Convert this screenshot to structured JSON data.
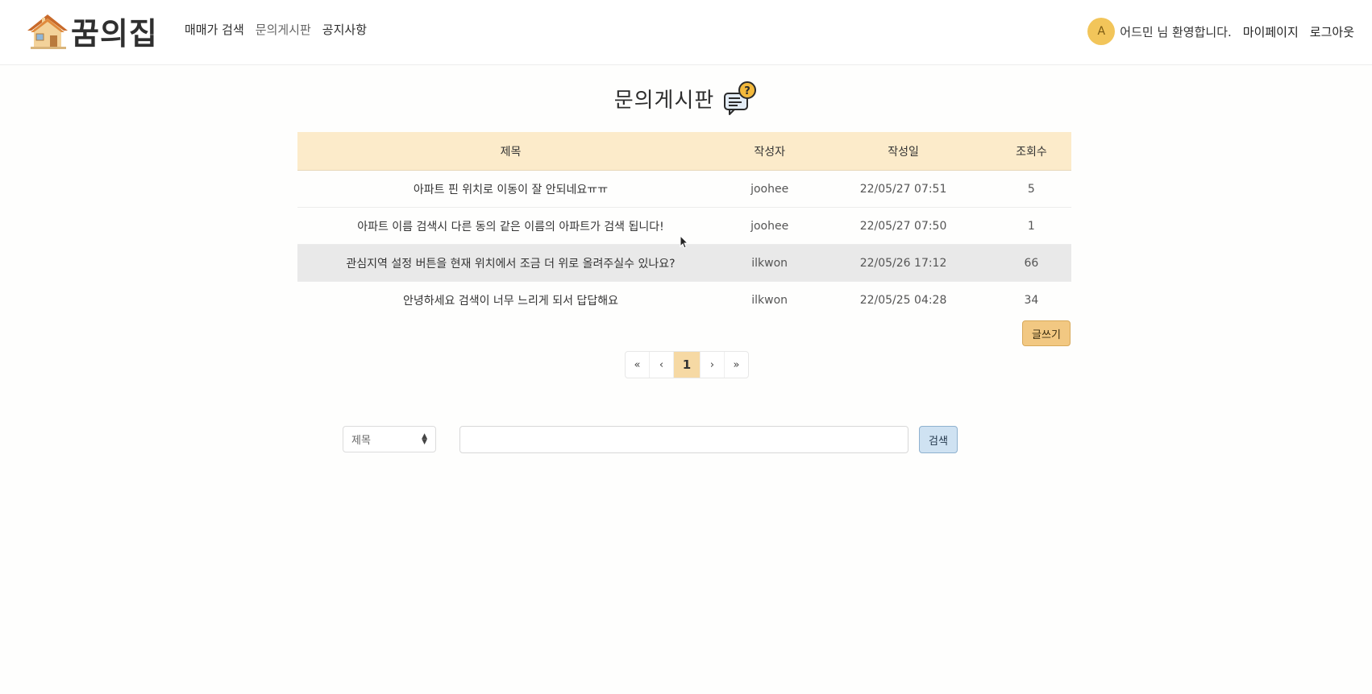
{
  "brand": {
    "name": "꿈의집"
  },
  "nav": {
    "items": [
      {
        "label": "매매가 검색"
      },
      {
        "label": "문의게시판"
      },
      {
        "label": "공지사항"
      }
    ]
  },
  "user": {
    "avatar_initial": "A",
    "welcome": "어드민 님 환영합니다.",
    "mypage": "마이페이지",
    "logout": "로그아웃"
  },
  "page": {
    "title": "문의게시판",
    "title_icon": "question-chat-icon"
  },
  "table": {
    "headers": {
      "title": "제목",
      "author": "작성자",
      "date": "작성일",
      "views": "조회수"
    },
    "rows": [
      {
        "title": "아파트 핀 위치로 이동이 잘 안되네요ㅠㅠ",
        "author": "joohee",
        "date": "22/05/27 07:51",
        "views": "5"
      },
      {
        "title": "아파트 이름 검색시 다른 동의 같은 이름의 아파트가 검색 됩니다!",
        "author": "joohee",
        "date": "22/05/27 07:50",
        "views": "1"
      },
      {
        "title": "관심지역 설정 버튼을 현재 위치에서 조금 더 위로 올려주실수 있나요?",
        "author": "ilkwon",
        "date": "22/05/26 17:12",
        "views": "66"
      },
      {
        "title": "안녕하세요 검색이 너무 느리게 되서 답답해요",
        "author": "ilkwon",
        "date": "22/05/25 04:28",
        "views": "34"
      }
    ]
  },
  "write_button": "글쓰기",
  "pagination": {
    "first": "«",
    "prev": "‹",
    "current": "1",
    "next": "›",
    "last": "»"
  },
  "search": {
    "select_value": "제목",
    "input_value": "",
    "button": "검색"
  },
  "colors": {
    "header_row": "#fcebca",
    "accent": "#f2c882",
    "search_button": "#cfe2f2",
    "avatar": "#f2c55a"
  }
}
